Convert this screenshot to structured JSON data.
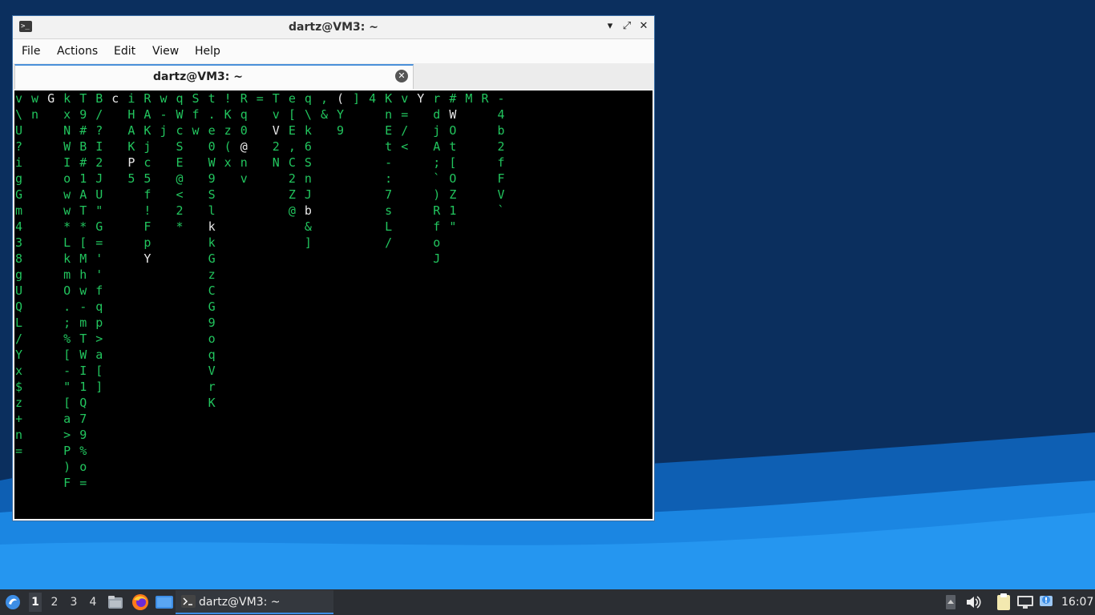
{
  "window": {
    "title": "dartz@VM3: ~",
    "minimize_glyph": "▾",
    "maximize_glyph": "⤢",
    "close_glyph": "✕"
  },
  "menu": {
    "items": [
      "File",
      "Actions",
      "Edit",
      "View",
      "Help"
    ]
  },
  "tab": {
    "title": "dartz@VM3: ~",
    "close_glyph": "✕"
  },
  "terminal": {
    "fg_color": "#22c55e",
    "highlight_color": "#e8e8e8",
    "bg_color": "#000000",
    "columns": [
      "v\\U?igGm438gUQL/Yx$z+n=",
      "wn",
      "G",
      "kxNWIoww*LkmO.;%[-\"[a>P)F",
      "T9#B#1AT*[Mhw-mTWI1Q79%o=",
      "B/?I2JU\"G=''fqp>a[]",
      "c",
      "iHAKP5",
      "RAKjc5f!FpY",
      "w-j",
      "qWcSE@<2*",
      "Sfw",
      "t.e0W9SlkkGzCG9oqVrK",
      "!Kz(x",
      "Rq0@nv",
      "=",
      "TvV2N",
      "e[E,C2Z@",
      "q\\k6SnJb&]",
      ",&",
      "(Y9",
      "]",
      "4",
      "KnEt-:7sL/",
      "v=/<",
      "Y",
      "rdjA;`)RfoJ",
      "#WOt[OZ1\"",
      "M",
      "R",
      "-4b2fFV`"
    ]
  },
  "taskbar": {
    "workspaces": [
      "1",
      "2",
      "3",
      "4"
    ],
    "active_workspace": "1",
    "task_title": "dartz@VM3: ~",
    "clock": "16:07"
  },
  "colors": {
    "desktop_dark": "#0b2f5e",
    "wave_light": "#1f8be8",
    "window_border": "#3a6ea5",
    "taskbar": "#2b2e33",
    "accent": "#3d8ee6"
  }
}
